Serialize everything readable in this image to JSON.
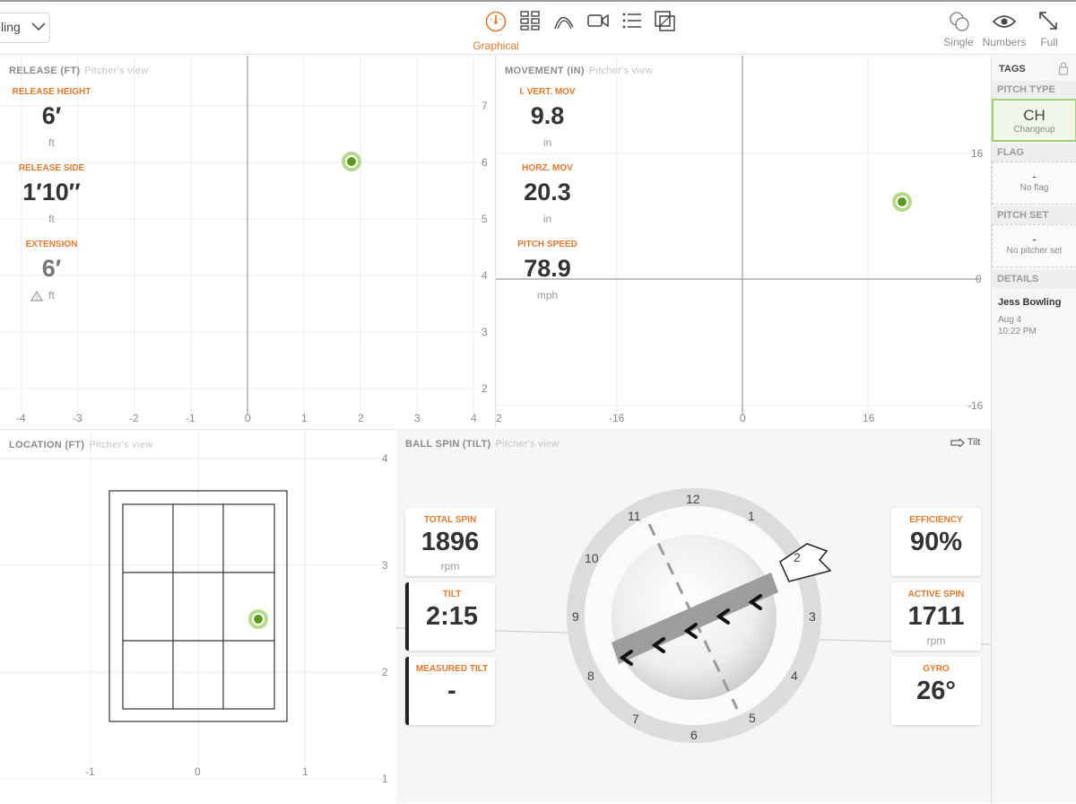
{
  "toolbar": {
    "player_value": "ling",
    "view_modes": [
      {
        "name": "graphical",
        "label": "Graphical",
        "active": true
      },
      {
        "name": "grid",
        "label": ""
      },
      {
        "name": "trajectory",
        "label": ""
      },
      {
        "name": "video",
        "label": ""
      },
      {
        "name": "list",
        "label": ""
      },
      {
        "name": "compare",
        "label": ""
      }
    ],
    "right": {
      "single": "Single",
      "numbers": "Numbers",
      "full": "Full"
    }
  },
  "colors": {
    "accent": "#e07a2e",
    "point": "#5a9a1a",
    "point_halo": "#b5d98a"
  },
  "release": {
    "title": "RELEASE (FT)",
    "subtitle": "Pitcher's view",
    "stats": [
      {
        "label": "RELEASE HEIGHT",
        "value": "6′",
        "unit": "ft"
      },
      {
        "label": "RELEASE SIDE",
        "value": "1′10″",
        "unit": "ft"
      },
      {
        "label": "EXTENSION",
        "value": "6′",
        "unit": "ft"
      }
    ],
    "x_ticks": [
      "-4",
      "-3",
      "-2",
      "-1",
      "0",
      "1",
      "2",
      "3",
      "4"
    ],
    "y_ticks": [
      "7",
      "6",
      "5",
      "4",
      "3",
      "2"
    ]
  },
  "movement": {
    "title": "MOVEMENT (IN)",
    "subtitle": "Pitcher's view",
    "stats": [
      {
        "label": "I. VERT. MOV",
        "value": "9.8",
        "unit": "in"
      },
      {
        "label": "HORZ. MOV",
        "value": "20.3",
        "unit": "in"
      },
      {
        "label": "PITCH SPEED",
        "value": "78.9",
        "unit": "mph"
      }
    ],
    "x_ticks": [
      "2",
      "-16",
      "0",
      "16"
    ],
    "y_ticks": [
      "16",
      "0",
      "-16"
    ]
  },
  "location": {
    "title": "LOCATION (FT)",
    "subtitle": "Pitcher's view",
    "x_ticks": [
      "-1",
      "0",
      "1"
    ],
    "y_ticks": [
      "4",
      "3",
      "2",
      "1"
    ]
  },
  "spin": {
    "title": "BALL SPIN (TILT)",
    "subtitle": "Pitcher's view",
    "tilt_toggle": "Tilt",
    "clock": [
      "12",
      "1",
      "2",
      "3",
      "4",
      "5",
      "6",
      "7",
      "8",
      "9",
      "10",
      "11"
    ],
    "cards_left": [
      {
        "label": "TOTAL SPIN",
        "value": "1896",
        "unit": "rpm"
      },
      {
        "label": "TILT",
        "value": "2:15",
        "unit": ""
      },
      {
        "label": "MEASURED TILT",
        "value": "-",
        "unit": ""
      }
    ],
    "cards_right": [
      {
        "label": "EFFICIENCY",
        "value": "90%",
        "unit": ""
      },
      {
        "label": "ACTIVE SPIN",
        "value": "1711",
        "unit": "rpm"
      },
      {
        "label": "GYRO",
        "value": "26°",
        "unit": ""
      }
    ]
  },
  "tags": {
    "title": "TAGS",
    "pitch_type_header": "PITCH TYPE",
    "pitch_type_code": "CH",
    "pitch_type_name": "Changeup",
    "flag_header": "FLAG",
    "flag_value": "-",
    "flag_text": "No flag",
    "pitch_set_header": "PITCH SET",
    "pitch_set_value": "-",
    "pitch_set_text": "No pitcher set",
    "details_header": "DETAILS",
    "pitcher": "Jess Bowling",
    "date": "Aug 4",
    "time": "10:22 PM"
  }
}
